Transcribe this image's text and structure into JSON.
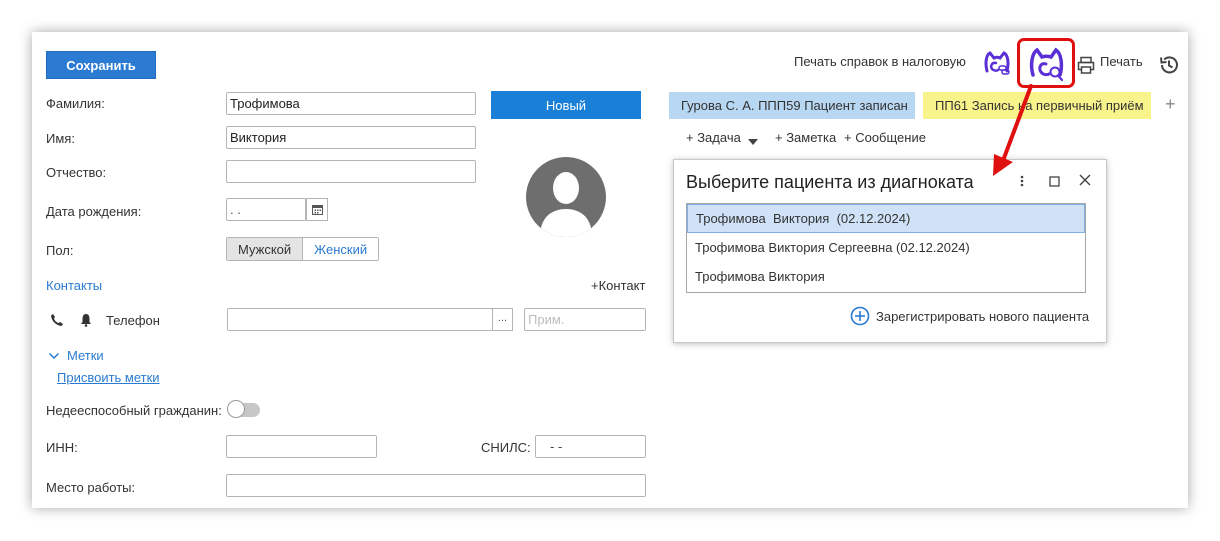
{
  "toolbar": {
    "save_label": "Сохранить",
    "print_tax_label": "Печать справок в налоговую",
    "print_label": "Печать",
    "new_button_label": "Новый"
  },
  "form": {
    "surname_label": "Фамилия:",
    "surname_value": "Трофимова",
    "name_label": "Имя:",
    "name_value": "Виктория",
    "patronymic_label": "Отчество:",
    "patronymic_value": "",
    "birthdate_label": "Дата рождения:",
    "birthdate_value": " .  .",
    "gender_label": "Пол:",
    "gender_male": "Мужской",
    "gender_female": "Женский",
    "contacts_label": "Контакты",
    "add_contact_label": "+Контакт",
    "phone_label": "Телефон",
    "phone_value": "",
    "phone_more": "...",
    "phone_note_placeholder": "Прим.",
    "tags_label": "Метки",
    "assign_tags_link": "Присвоить метки",
    "incapable_label": "Недееспособный гражданин:",
    "inn_label": "ИНН:",
    "inn_value": "",
    "snils_label": "СНИЛС:",
    "snils_value": "-   -",
    "workplace_label": "Место работы:",
    "workplace_value": ""
  },
  "tabs": [
    {
      "label": "Гурова С. А. ППП59  Пациент записан"
    },
    {
      "label": "ПП61  Запись на первичный приём"
    }
  ],
  "actions": {
    "task": "+ Задача",
    "note": "+ Заметка",
    "message": "+ Сообщение"
  },
  "popup": {
    "title": "Выберите пациента из диагноката",
    "items": [
      {
        "label": "Трофимова  Виктория  (02.12.2024)"
      },
      {
        "label": "Трофимова Виктория Сергеевна (02.12.2024)"
      },
      {
        "label": "Трофимова Виктория"
      }
    ],
    "register_label": "Зарегистрировать нового пациента"
  },
  "colors": {
    "accent": "#2a7bd1",
    "tab_blue": "#b8d7f2",
    "tab_yellow": "#f9f38c",
    "highlight": "#e01010",
    "brand_icon": "#5b2fd6"
  }
}
